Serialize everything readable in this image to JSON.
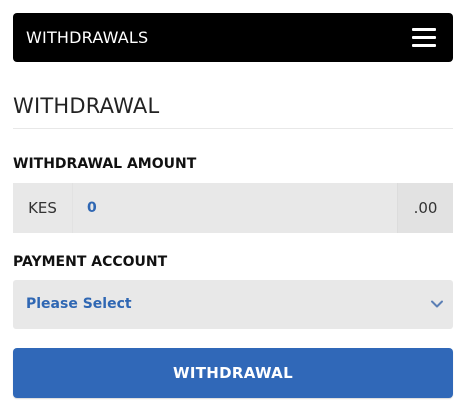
{
  "header": {
    "title": "WITHDRAWALS",
    "menu_icon": "hamburger-menu-icon"
  },
  "form": {
    "section_title": "WITHDRAWAL",
    "amount": {
      "label": "WITHDRAWAL AMOUNT",
      "currency": "KES",
      "value": "0",
      "suffix": ".00"
    },
    "account": {
      "label": "PAYMENT ACCOUNT",
      "selected": "Please Select",
      "dropdown_icon": "chevron-down-icon"
    },
    "submit_label": "WITHDRAWAL"
  },
  "colors": {
    "header_bg": "#000000",
    "accent": "#3068b8",
    "input_bg": "#e8e8e8",
    "value_text": "#2f67b3"
  }
}
